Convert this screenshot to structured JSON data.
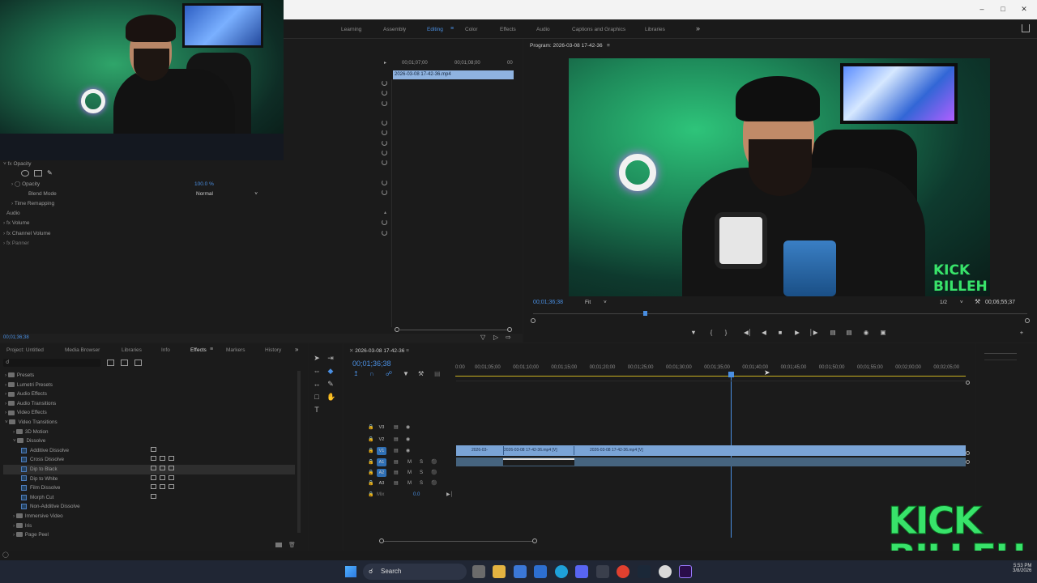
{
  "workspaces": [
    "Learning",
    "Assembly",
    "Editing",
    "Color",
    "Effects",
    "Audio",
    "Captions and Graphics",
    "Libraries"
  ],
  "more_label": "»",
  "effect_controls": {
    "clip_name": "2026-03-08 17-42-36.mp4",
    "timecodes": [
      "00;01;07;00",
      "00;01;08;00",
      "00"
    ],
    "opacity_section": "Opacity",
    "opacity_label": "Opacity",
    "opacity_value": "100.0 %",
    "blend_mode_label": "Blend Mode",
    "blend_mode_value": "Normal",
    "time_remapping": "Time Remapping",
    "audio_label": "Audio",
    "volume": "Volume",
    "channel_volume": "Channel Volume",
    "panner": "Panner",
    "bottom_timecode": "00;01;36;38"
  },
  "program": {
    "title": "Program: 2026-03-08 17-42-36",
    "timecode": "00;01;36;38",
    "fit": "Fit",
    "quality": "1/2",
    "duration": "00;06;55;37"
  },
  "project_panel": {
    "tabs": [
      "Project: Untitled",
      "Media Browser",
      "Libraries",
      "Info",
      "Effects",
      "Markers",
      "History"
    ],
    "tree": [
      {
        "label": "Presets",
        "indent": 0,
        "type": "folder"
      },
      {
        "label": "Lumetri Presets",
        "indent": 0,
        "type": "folder"
      },
      {
        "label": "Audio Effects",
        "indent": 0,
        "type": "folder"
      },
      {
        "label": "Audio Transitions",
        "indent": 0,
        "type": "folder"
      },
      {
        "label": "Video Effects",
        "indent": 0,
        "type": "folder"
      },
      {
        "label": "Video Transitions",
        "indent": 0,
        "type": "folder"
      },
      {
        "label": "3D Motion",
        "indent": 1,
        "type": "folder"
      },
      {
        "label": "Dissolve",
        "indent": 1,
        "type": "folder"
      },
      {
        "label": "Additive Dissolve",
        "indent": 2,
        "type": "effect",
        "badges": 1
      },
      {
        "label": "Cross Dissolve",
        "indent": 2,
        "type": "effect",
        "badges": 3
      },
      {
        "label": "Dip to Black",
        "indent": 2,
        "type": "effect",
        "badges": 3,
        "selected": true
      },
      {
        "label": "Dip to White",
        "indent": 2,
        "type": "effect",
        "badges": 3
      },
      {
        "label": "Film Dissolve",
        "indent": 2,
        "type": "effect",
        "badges": 3
      },
      {
        "label": "Morph Cut",
        "indent": 2,
        "type": "effect",
        "badges": 1
      },
      {
        "label": "Non-Additive Dissolve",
        "indent": 2,
        "type": "effect",
        "badges": 0
      },
      {
        "label": "Immersive Video",
        "indent": 1,
        "type": "folder"
      },
      {
        "label": "Iris",
        "indent": 1,
        "type": "folder"
      },
      {
        "label": "Page Peel",
        "indent": 1,
        "type": "folder"
      }
    ]
  },
  "timeline": {
    "sequence_tab": "2026-03-08 17-42-36",
    "timecode": "00;01;36;38",
    "ruler": [
      "0:00",
      "00;01;05;00",
      "00;01;10;00",
      "00;01;15;00",
      "00;01;20;00",
      "00;01;25;00",
      "00;01;30;00",
      "00;01;35;00",
      "00;01;40;00",
      "00;01;45;00",
      "00;01;50;00",
      "00;01;55;00",
      "00;02;00;00",
      "00;02;05;00"
    ],
    "video_tracks": [
      "V3",
      "V2",
      "V1"
    ],
    "audio_tracks": [
      "A1",
      "A2",
      "A3"
    ],
    "mix_label": "Mix",
    "mix_value": "0.0",
    "clips": [
      "2026-03-",
      "2026-03-08 17-42-36.mp4 [V]",
      "2026-03-08 17-42-36.mp4 [V]"
    ],
    "mute": "M",
    "solo": "S"
  },
  "taskbar": {
    "search": "Search",
    "time": "5:53 PM",
    "date": "3/8/2026"
  },
  "overlay": {
    "logo": "KICK BILLEH"
  },
  "colors": {
    "accent": "#4a8fe2",
    "clip": "#7aa4d6",
    "playhead": "#4a8fe2",
    "green": "#38e36a"
  }
}
